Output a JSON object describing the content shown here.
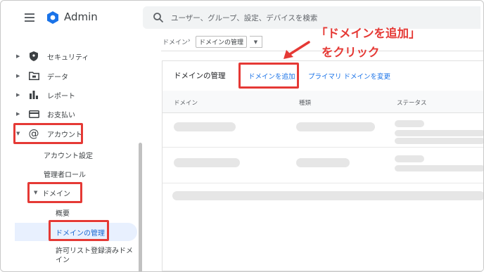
{
  "header": {
    "app_title": "Admin",
    "search_placeholder": "ユーザー、グループ、設定、デバイスを検索"
  },
  "sidebar": {
    "items": [
      {
        "label": "セキュリティ",
        "icon": "shield-icon"
      },
      {
        "label": "データ",
        "icon": "folder-icon"
      },
      {
        "label": "レポート",
        "icon": "bar-chart-icon"
      },
      {
        "label": "お支払い",
        "icon": "credit-card-icon"
      },
      {
        "label": "アカウント",
        "icon": "at-sign-icon"
      }
    ],
    "account_sub": [
      "アカウント設定",
      "管理者ロール"
    ],
    "domain_label": "ドメイン",
    "domain_sub": [
      "概要",
      "ドメインの管理",
      "許可リスト登録済みドメ",
      "イン"
    ]
  },
  "breadcrumb": {
    "root": "ドメイン",
    "separator": "›",
    "current": "ドメインの管理"
  },
  "card": {
    "title": "ドメインの管理",
    "add_domain": "ドメインを追加",
    "change_primary": "プライマリ ドメインを変更",
    "columns": [
      "ドメイン",
      "種類",
      "ステータス"
    ]
  },
  "annotation": {
    "line1": "「ドメインを追加」",
    "line2": "をクリック"
  },
  "colors": {
    "highlight": "#e53935",
    "link": "#1a73e8",
    "active_bg": "#e8f0fe"
  }
}
